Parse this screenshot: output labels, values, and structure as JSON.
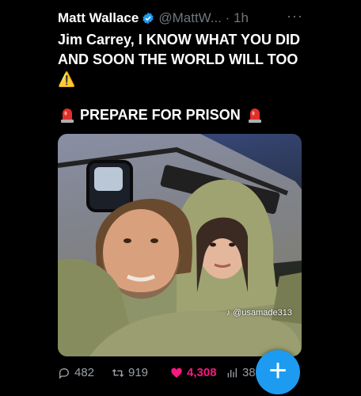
{
  "post": {
    "display_name": "Matt Wallace",
    "handle_time": "@MattW... · 1h",
    "more": "···",
    "text_main": "Jim Carrey, I KNOW WHAT YOU DID AND SOON THE WORLD WILL TOO ⚠️",
    "text_second": "PREPARE FOR PRISON",
    "verified_color": "#1d9bf0"
  },
  "media": {
    "watermark": "@usamade313",
    "icon": "tiktok-icon"
  },
  "actions": {
    "replies": "482",
    "reposts": "919",
    "likes": "4,308",
    "views": "38",
    "like_color": "#f91880"
  },
  "fab": {
    "label": "+",
    "color": "#1d9bf0"
  }
}
